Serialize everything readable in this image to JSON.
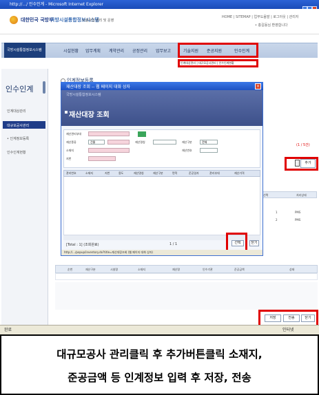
{
  "browser": {
    "title": "http://.../ 인수인계 - Microsoft Internet Explorer",
    "status_left": "완료",
    "status_right": "인터넷"
  },
  "site": {
    "org_name": "대한민국 국방부",
    "system_name": "국방시설통합정보시스템",
    "system_sub": "시설사업 관리 및 운영",
    "util_links": "HOME | SITEMAP | 업무도움말 | 로그아웃 | 관리자",
    "util_links2": "• 홍길동님 환영합니다"
  },
  "nav": {
    "brand": "국방시설통합정보시스템",
    "items": [
      "시설현황",
      "업무계획",
      "계약관리",
      "공정관리",
      "업무보고",
      "기술지원",
      "준공지원",
      "인수인계"
    ],
    "submenu": "인계대상관리 | 대규모공사관리 | 인수인계현황"
  },
  "left_menu": {
    "title": "인수인계",
    "items": [
      "인계대상관리",
      "대규모공사관리",
      "• 인계정보등록",
      "인수인계현황"
    ],
    "selected": "대규모공사관리"
  },
  "page": {
    "title": "인계정보등록",
    "red_count": "(1 / 5건)",
    "add_label": "추가",
    "save_label": "저장",
    "send_label": "전송",
    "close_label": "닫기",
    "lower_headers": [
      "순번",
      "재산구분",
      "시설명",
      "소재지",
      "재산명",
      "인수기관",
      "준공금액",
      "상태"
    ],
    "right_headers": [
      "선택",
      "처리상태"
    ],
    "right_rows": [
      [
        "1",
        "PMS"
      ],
      [
        "2",
        "PMS"
      ]
    ]
  },
  "popup": {
    "title": "재산대장 조회 -- 웹 페이지 대화 상자",
    "subtitle": "국방시설통합정보시스템",
    "heading": "재산대장 조회",
    "labels": [
      "재산관리부대",
      "재산종류",
      "소재지",
      "지번",
      "재산명칭",
      "재산구분",
      "재산번호",
      "준공일자"
    ],
    "select_values": [
      "건물",
      "전체"
    ],
    "grid_headers": [
      "관리번호",
      "소재지",
      "지번",
      "용도",
      "재산명칭",
      "재산구분",
      "면적",
      "준공일자",
      "관리부대",
      "재산가격"
    ],
    "count_text": "[Total : 1] (조회완료)",
    "page_text": "1 / 1",
    "select_label": "선택",
    "close_label": "닫기",
    "url": "http://.../popup/inventory.do?title=재산대장조회 (웹 페이지 대화 상자)"
  },
  "caption": {
    "line1": "대규모공사 관리클릭 후 추가버튼클릭 소재지,",
    "line2": "준공금액 등 인계정보 입력 후 저장, 전송"
  },
  "colors": {
    "highlight": "#e00000",
    "nav_brand": "#1d3f7c",
    "popup_header": "#4a5e98"
  }
}
